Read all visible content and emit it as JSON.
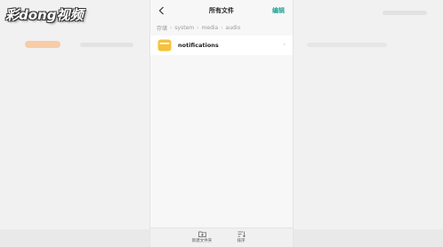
{
  "watermark": {
    "text": "彩dong视频"
  },
  "header": {
    "title": "所有文件",
    "edit_label": "编辑"
  },
  "breadcrumb": {
    "items": [
      "存储",
      "system",
      "media",
      "audio"
    ],
    "separator": "›"
  },
  "files": [
    {
      "name": "notifications",
      "type": "folder"
    }
  ],
  "bottom_bar": {
    "new_folder_label": "新建文件夹",
    "sort_label": "排序"
  },
  "colors": {
    "accent": "#1fa59a",
    "folder": "#f5c23c"
  }
}
